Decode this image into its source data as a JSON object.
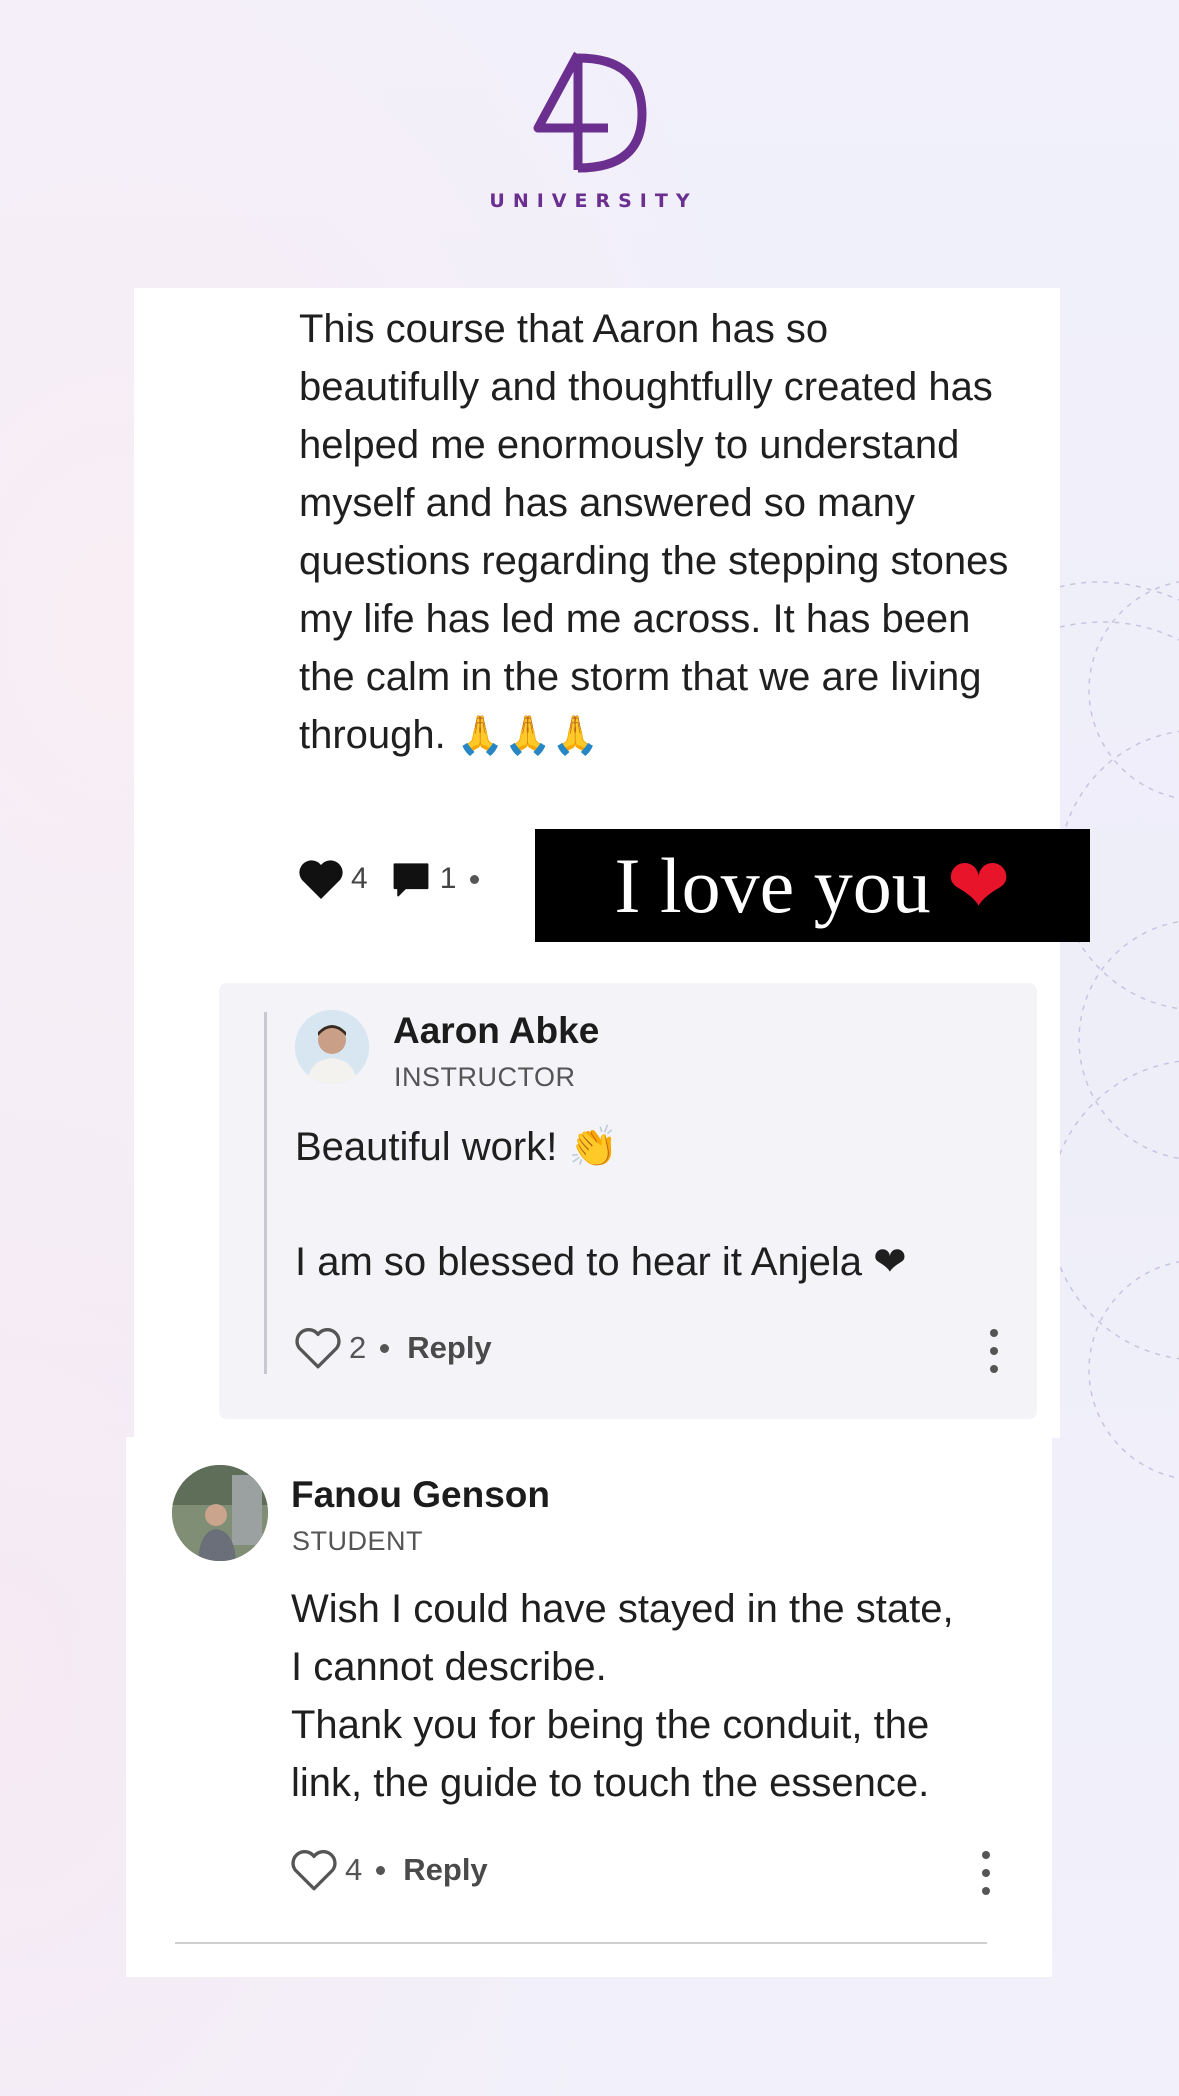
{
  "brand": {
    "logo_text": "4D",
    "subtitle": "UNIVERSITY",
    "color": "#6b2f8f"
  },
  "post": {
    "text": "This course that Aaron has so beautifully and thoughtfully created has helped me enormously to understand myself and has answered so many questions regarding the stepping stones my life has led me across. It has been the calm in the storm that we are living through.",
    "emoji": "🙏🙏🙏",
    "likes": "4",
    "comments": "1"
  },
  "overlay": {
    "text": "I love you",
    "emoji": "❤"
  },
  "reply": {
    "author": "Aaron Abke",
    "role": "INSTRUCTOR",
    "line1": "Beautiful work! 👏",
    "line2": "I am so blessed to hear it Anjela ❤",
    "likes": "2",
    "reply_label": "Reply"
  },
  "comment": {
    "author": "Fanou Genson",
    "role": "STUDENT",
    "line1": "Wish I could have stayed in the state,",
    "line2": "I cannot describe.",
    "line3": "Thank you for being the conduit, the",
    "line4": "link, the guide to touch the essence.",
    "likes": "4",
    "reply_label": "Reply"
  },
  "colors": {
    "heart_red": "#e8142a",
    "card_bg": "#ffffff",
    "reply_bg": "#f3f3f8"
  }
}
